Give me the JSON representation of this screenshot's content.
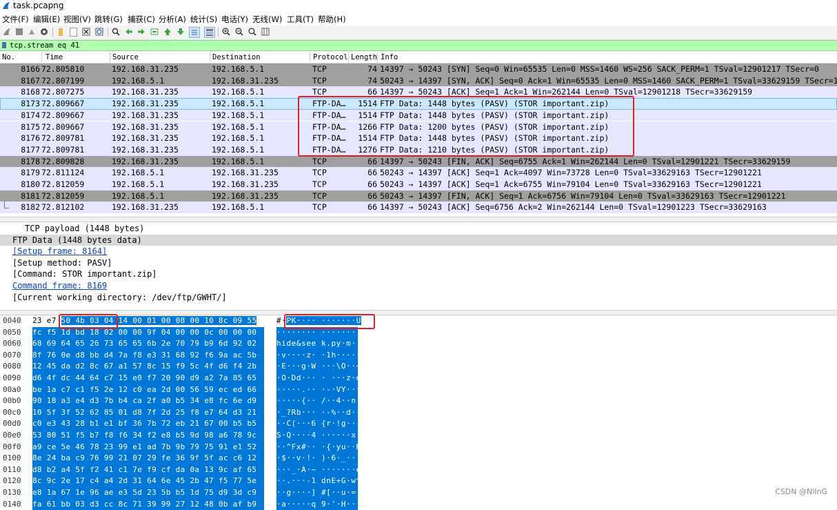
{
  "window": {
    "title": "task.pcapng"
  },
  "menu": [
    "文件(F)",
    "编辑(E)",
    "视图(V)",
    "跳转(G)",
    "捕获(C)",
    "分析(A)",
    "统计(S)",
    "电话(Y)",
    "无线(W)",
    "工具(T)",
    "帮助(H)"
  ],
  "toolbar_icons": [
    "shark-fin-start-icon",
    "stop-icon",
    "restart-icon",
    "options-gear-icon",
    "open-folder-icon",
    "save-file-icon",
    "close-file-icon",
    "reload-icon",
    "search-icon",
    "back-arrow-icon",
    "forward-arrow-icon",
    "goto-packet-icon",
    "first-packet-icon",
    "last-packet-icon",
    "autoscroll-icon",
    "colorize-icon",
    "zoom-in-icon",
    "zoom-out-icon",
    "zoom-reset-icon",
    "resize-columns-icon"
  ],
  "filter": {
    "value": "tcp.stream eq 41"
  },
  "packet_list": {
    "columns": [
      "No.",
      "Time",
      "Source",
      "Destination",
      "Protocol",
      "Length",
      "Info"
    ],
    "rows": [
      {
        "no": "8166",
        "time": "72.805810",
        "src": "192.168.31.235",
        "dst": "192.168.5.1",
        "proto": "TCP",
        "len": "74",
        "info": "14397 → 50243 [SYN] Seq=0 Win=65535 Len=0 MSS=1460 WS=256 SACK_PERM=1 TSval=12901217 TSecr=0",
        "style": "dark"
      },
      {
        "no": "8167",
        "time": "72.807199",
        "src": "192.168.5.1",
        "dst": "192.168.31.235",
        "proto": "TCP",
        "len": "74",
        "info": "50243 → 14397 [SYN, ACK] Seq=0 Ack=1 Win=65535 Len=0 MSS=1460 SACK_PERM=1 TSval=33629159 TSecr=1",
        "style": "dark"
      },
      {
        "no": "8168",
        "time": "72.807275",
        "src": "192.168.31.235",
        "dst": "192.168.5.1",
        "proto": "TCP",
        "len": "66",
        "info": "14397 → 50243 [ACK] Seq=1 Ack=1 Win=262144 Len=0 TSval=12901218 TSecr=33629159",
        "style": "light"
      },
      {
        "no": "8173",
        "time": "72.809667",
        "src": "192.168.31.235",
        "dst": "192.168.5.1",
        "proto": "FTP-DA…",
        "len": "1514",
        "info": "FTP Data: 1448 bytes (PASV) (STOR important.zip)",
        "style": "selected"
      },
      {
        "no": "8174",
        "time": "72.809667",
        "src": "192.168.31.235",
        "dst": "192.168.5.1",
        "proto": "FTP-DA…",
        "len": "1514",
        "info": "FTP Data: 1448 bytes (PASV) (STOR important.zip)",
        "style": "light"
      },
      {
        "no": "8175",
        "time": "72.809667",
        "src": "192.168.31.235",
        "dst": "192.168.5.1",
        "proto": "FTP-DA…",
        "len": "1266",
        "info": "FTP Data: 1200 bytes (PASV) (STOR important.zip)",
        "style": "light"
      },
      {
        "no": "8176",
        "time": "72.809781",
        "src": "192.168.31.235",
        "dst": "192.168.5.1",
        "proto": "FTP-DA…",
        "len": "1514",
        "info": "FTP Data: 1448 bytes (PASV) (STOR important.zip)",
        "style": "light"
      },
      {
        "no": "8177",
        "time": "72.809781",
        "src": "192.168.31.235",
        "dst": "192.168.5.1",
        "proto": "FTP-DA…",
        "len": "1276",
        "info": "FTP Data: 1210 bytes (PASV) (STOR important.zip)",
        "style": "light"
      },
      {
        "no": "8178",
        "time": "72.809828",
        "src": "192.168.31.235",
        "dst": "192.168.5.1",
        "proto": "TCP",
        "len": "66",
        "info": "14397 → 50243 [FIN, ACK] Seq=6755 Ack=1 Win=262144 Len=0 TSval=12901221 TSecr=33629159",
        "style": "dark"
      },
      {
        "no": "8179",
        "time": "72.811124",
        "src": "192.168.5.1",
        "dst": "192.168.31.235",
        "proto": "TCP",
        "len": "66",
        "info": "50243 → 14397 [ACK] Seq=1 Ack=4097 Win=73728 Len=0 TSval=33629163 TSecr=12901221",
        "style": "light"
      },
      {
        "no": "8180",
        "time": "72.812059",
        "src": "192.168.5.1",
        "dst": "192.168.31.235",
        "proto": "TCP",
        "len": "66",
        "info": "50243 → 14397 [ACK] Seq=1 Ack=6755 Win=79104 Len=0 TSval=33629163 TSecr=12901221",
        "style": "light"
      },
      {
        "no": "8181",
        "time": "72.812059",
        "src": "192.168.5.1",
        "dst": "192.168.31.235",
        "proto": "TCP",
        "len": "66",
        "info": "50243 → 14397 [FIN, ACK] Seq=1 Ack=6756 Win=79104 Len=0 TSval=33629163 TSecr=12901221",
        "style": "dark"
      },
      {
        "no": "8182",
        "time": "72.812102",
        "src": "192.168.31.235",
        "dst": "192.168.5.1",
        "proto": "TCP",
        "len": "66",
        "info": "14397 → 50243 [ACK] Seq=6756 Ack=2 Win=262144 Len=0 TSval=12901223 TSecr=33629163",
        "style": "light"
      }
    ]
  },
  "details": [
    {
      "text": "TCP payload (1448 bytes)",
      "indent": 2,
      "style": "plain"
    },
    {
      "text": "FTP Data (1448 bytes data)",
      "indent": 1,
      "style": "hl"
    },
    {
      "text": "[Setup frame: 8164]",
      "indent": 1,
      "style": "link"
    },
    {
      "text": "[Setup method: PASV]",
      "indent": 1,
      "style": "plain"
    },
    {
      "text": "[Command: STOR important.zip]",
      "indent": 1,
      "style": "plain"
    },
    {
      "text": "Command frame: 8169",
      "indent": 1,
      "style": "link"
    },
    {
      "text": "[Current working directory: /dev/ftp/GWHT/]",
      "indent": 1,
      "style": "plain"
    }
  ],
  "hex": {
    "first": {
      "off": "0040",
      "pre": "23 e7 ",
      "hex": "50 4b 03 04 14 00  01 00 08 00 10 8c 09 55",
      "asc_pre": "#·",
      "asc": "PK····  ·······U"
    },
    "rows": [
      {
        "off": "0050",
        "hex": "fc f5 1d bd 18 02 00 00  9f 04 00 00 0c 00 00 00",
        "asc": "········ ········"
      },
      {
        "off": "0060",
        "hex": "68 69 64 65 26 73 65 65  6b 2e 70 79 b9 6d 92 02",
        "asc": "hide&see k.py·m··"
      },
      {
        "off": "0070",
        "hex": "8f 76 0e d8 bb d4 7a f8  e3 31 68 92 f6 9a ac 5b",
        "asc": "·v····z· ·1h····["
      },
      {
        "off": "0080",
        "hex": "12 45 da d2 8c 67 a1 57  8c 15 f9 5c 4f d6 f4 2b",
        "asc": "·E···g·W ···\\O··+"
      },
      {
        "off": "0090",
        "hex": "d6 4f dc 44 64 c7 15 e0  f7 20 90 d9 a2 7a 85 65",
        "asc": "·O·Dd··· · ···z·e"
      },
      {
        "off": "00a0",
        "hex": "be 1a c7 c1 f5 2e 12 c0  ea 2d 00 56 59 ec ed 66",
        "asc": "·····.·· ·-·VY··f"
      },
      {
        "off": "00b0",
        "hex": "90 18 a3 e4 d3 7b b4 ca  2f a0 b5 34 e8 fc 6e d9",
        "asc": "·····{·· /··4··n·"
      },
      {
        "off": "00c0",
        "hex": "10 5f 3f 52 62 85 01 d8  7f 2d 25 f8 e7 64 d3 21",
        "asc": "·_?Rb··· ·-%··d·!"
      },
      {
        "off": "00d0",
        "hex": "c0 e3 43 28 b1 e1 bf 36  7b 72 eb 21 67 00 b5 b5",
        "asc": "··C(···6 {r·!g···"
      },
      {
        "off": "00e0",
        "hex": "53 80 51 f5 b7 f8 f6 34  f2 e8 b5 9d 98 a6 78 9c",
        "asc": "S·Q····4 ······x·"
      },
      {
        "off": "00f0",
        "hex": "a9 ce 5e 46 78 23 99 e1  ad 7b 9b 79 75 91 e1 52",
        "asc": "··^Fx#·· ·{·yu··R"
      },
      {
        "off": "0100",
        "hex": "8e 24 ba c9 76 99 21 07  29 fe 36 9f 5f ac c6 12",
        "asc": "·$··v·!· )·6·_···"
      },
      {
        "off": "0110",
        "hex": "d8 b2 a4 5f f2 41 c1 7e  f9 cf da 0a 13 9c af 65",
        "asc": "···_·A·~ ·······e"
      },
      {
        "off": "0120",
        "hex": "8c 9c 2e 17 c4 a4 2d 31  64 6e 45 2b 47 f5 77 5e",
        "asc": "··.···-1 dnE+G·w^"
      },
      {
        "off": "0130",
        "hex": "e8 1a 67 1e 96 ae e3 5d  23 5b b5 1d 75 d9 3d c9",
        "asc": "··g····] #[··u·=·"
      },
      {
        "off": "0140",
        "hex": "fa 61 bb 03 d3 cc 8c 71  39 99 27 12 48 0b af b9",
        "asc": "·a·····q 9·'·H···"
      }
    ]
  },
  "watermark": "CSDN @NlInG",
  "colors": {
    "dark_row": "#a0a0a0",
    "light_row": "#e7e6ff",
    "selected_row": "#cce8ff",
    "hex_select": "#0078d7",
    "filter_bg": "#afffaf",
    "annotation": "#e02020"
  }
}
